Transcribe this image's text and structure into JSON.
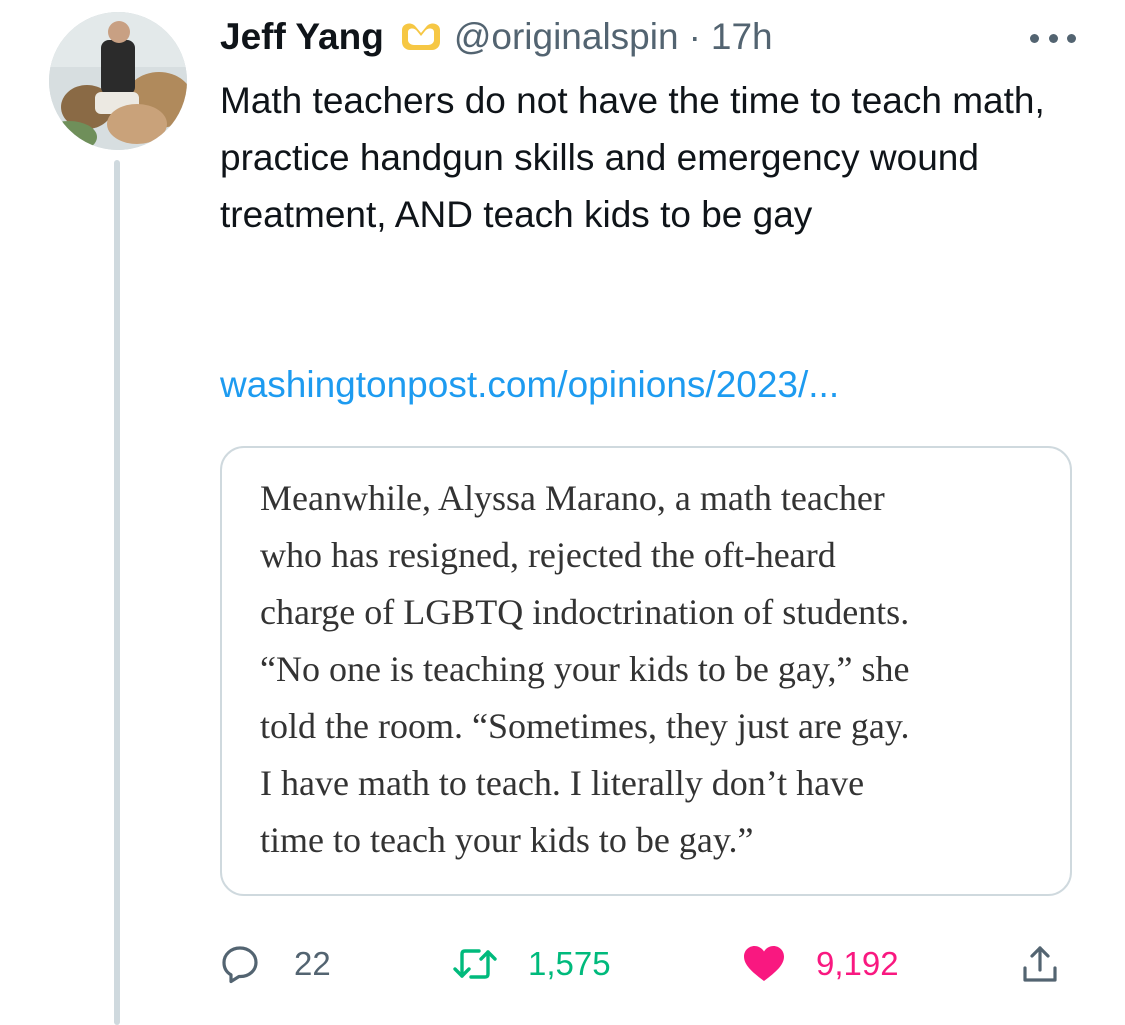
{
  "tweet": {
    "author_name": "Jeff Yang",
    "handle": "@originalspin",
    "separator": "·",
    "time": "17h",
    "text": "Math teachers do not have the time to teach math, practice handgun skills and emergency wound treatment, AND teach kids to be gay",
    "link": "washingtonpost.com/opinions/2023/...",
    "badge_icon": "heart-hands-icon",
    "more_icon": "more-options-icon"
  },
  "quote_card": {
    "text_lines": [
      "Meanwhile, Alyssa Marano, a math teacher",
      "who has resigned, rejected the oft-heard",
      "charge of LGBTQ indoctrination of students.",
      "“No one is teaching your kids to be gay,” she",
      "told the room. “Sometimes, they just are gay.",
      "I have math to teach. I literally don’t have",
      "time to teach your kids to be gay.”"
    ]
  },
  "actions": {
    "reply_count": "22",
    "retweet_count": "1,575",
    "like_count": "9,192",
    "reply_icon": "reply-bubble-icon",
    "retweet_icon": "retweet-icon",
    "like_icon": "heart-icon",
    "share_icon": "share-icon"
  },
  "colors": {
    "text_primary": "#0f1419",
    "text_secondary": "#536471",
    "link": "#1d9bf0",
    "retweet": "#00ba7c",
    "like": "#f91880",
    "badge": "#f6c744",
    "thread_line": "#cfd9de"
  }
}
